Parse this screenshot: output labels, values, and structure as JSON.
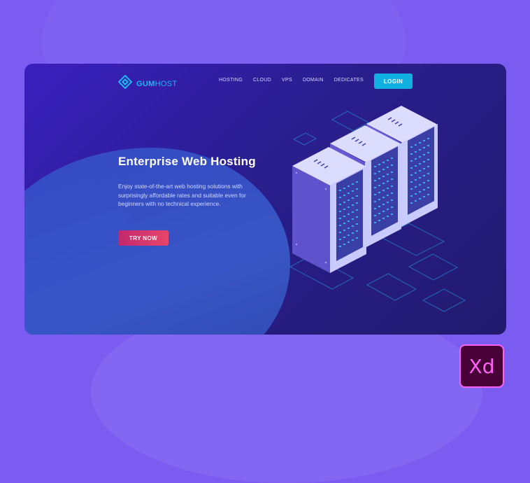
{
  "logo": {
    "brand_primary": "GUM",
    "brand_secondary": "HOST",
    "icon": "diamond-logo-icon"
  },
  "nav": {
    "items": [
      "HOSTING",
      "CLOUD",
      "VPS",
      "DOMAIN",
      "DEDICATES"
    ],
    "login_label": "LOGIN"
  },
  "hero": {
    "title": "Enterprise Web Hosting",
    "description": "Enjoy state-of-the-art web hosting solutions with surprisingly affordable rates and suitable even for beginners with no technical experience.",
    "cta_label": "TRY NOW"
  },
  "badge": {
    "label": "Xd",
    "icon": "adobe-xd-icon"
  },
  "colors": {
    "page_bg": "#7b5cf0",
    "card_bg": "#2a1e8e",
    "accent_cyan": "#12b0e0",
    "cta_pink": "#e8456a",
    "xd_magenta": "#ff61f6"
  }
}
